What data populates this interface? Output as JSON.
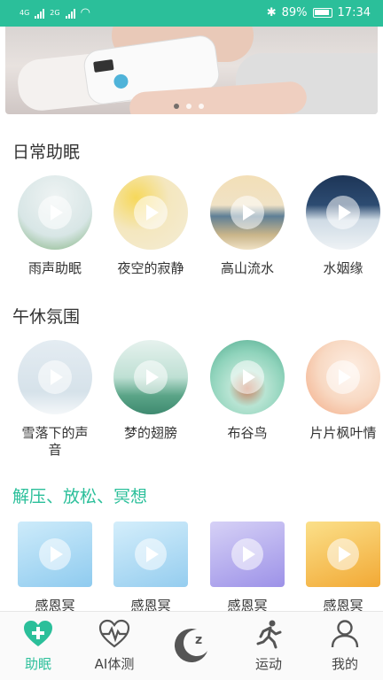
{
  "status_bar": {
    "network_1": "4G",
    "network_2": "2G",
    "battery": "89%",
    "time": "17:34"
  },
  "sections": {
    "daily": {
      "title": "日常助眠",
      "items": [
        {
          "label": "雨声助眠",
          "colors": [
            "#dfe9ea",
            "#6fa36a"
          ]
        },
        {
          "label": "夜空的寂静",
          "colors": [
            "#f6ecc4",
            "#e0b95a"
          ]
        },
        {
          "label": "高山流水",
          "colors": [
            "#f2e4c4",
            "#6d8fa6"
          ]
        },
        {
          "label": "水姻缘",
          "colors": [
            "#1e3a5c",
            "#dfe8ee"
          ]
        }
      ]
    },
    "nap": {
      "title": "午休氛围",
      "items": [
        {
          "label": "雪落下的声音",
          "colors": [
            "#dbe6ee",
            "#8a5f4a"
          ]
        },
        {
          "label": "梦的翅膀",
          "colors": [
            "#cfe7df",
            "#4e9c7e"
          ]
        },
        {
          "label": "布谷鸟",
          "colors": [
            "#9ed9c4",
            "#3b8f77"
          ]
        },
        {
          "label": "片片枫叶情",
          "colors": [
            "#f9e0cc",
            "#f2a07a"
          ]
        }
      ]
    },
    "relax": {
      "title": "解压、放松、冥想",
      "items": [
        {
          "label": "感恩冥",
          "colors": [
            "#b6e0f6",
            "#7fc2ea"
          ]
        },
        {
          "label": "感恩冥",
          "colors": [
            "#bfe3f7",
            "#86c6ec"
          ]
        },
        {
          "label": "感恩冥",
          "colors": [
            "#c9c3f2",
            "#9a8fe6"
          ]
        },
        {
          "label": "感恩冥",
          "colors": [
            "#f8d370",
            "#f0aa33"
          ]
        }
      ]
    }
  },
  "tabbar": {
    "items": [
      {
        "label": "助眠",
        "icon": "plus-heart-icon",
        "active": true
      },
      {
        "label": "AI体测",
        "icon": "heartbeat-icon",
        "active": false
      },
      {
        "label": "",
        "icon": "moon-sleep-icon",
        "active": false
      },
      {
        "label": "运动",
        "icon": "runner-icon",
        "active": false
      },
      {
        "label": "我的",
        "icon": "person-icon",
        "active": false
      }
    ],
    "accent": "#2bbf9a"
  }
}
